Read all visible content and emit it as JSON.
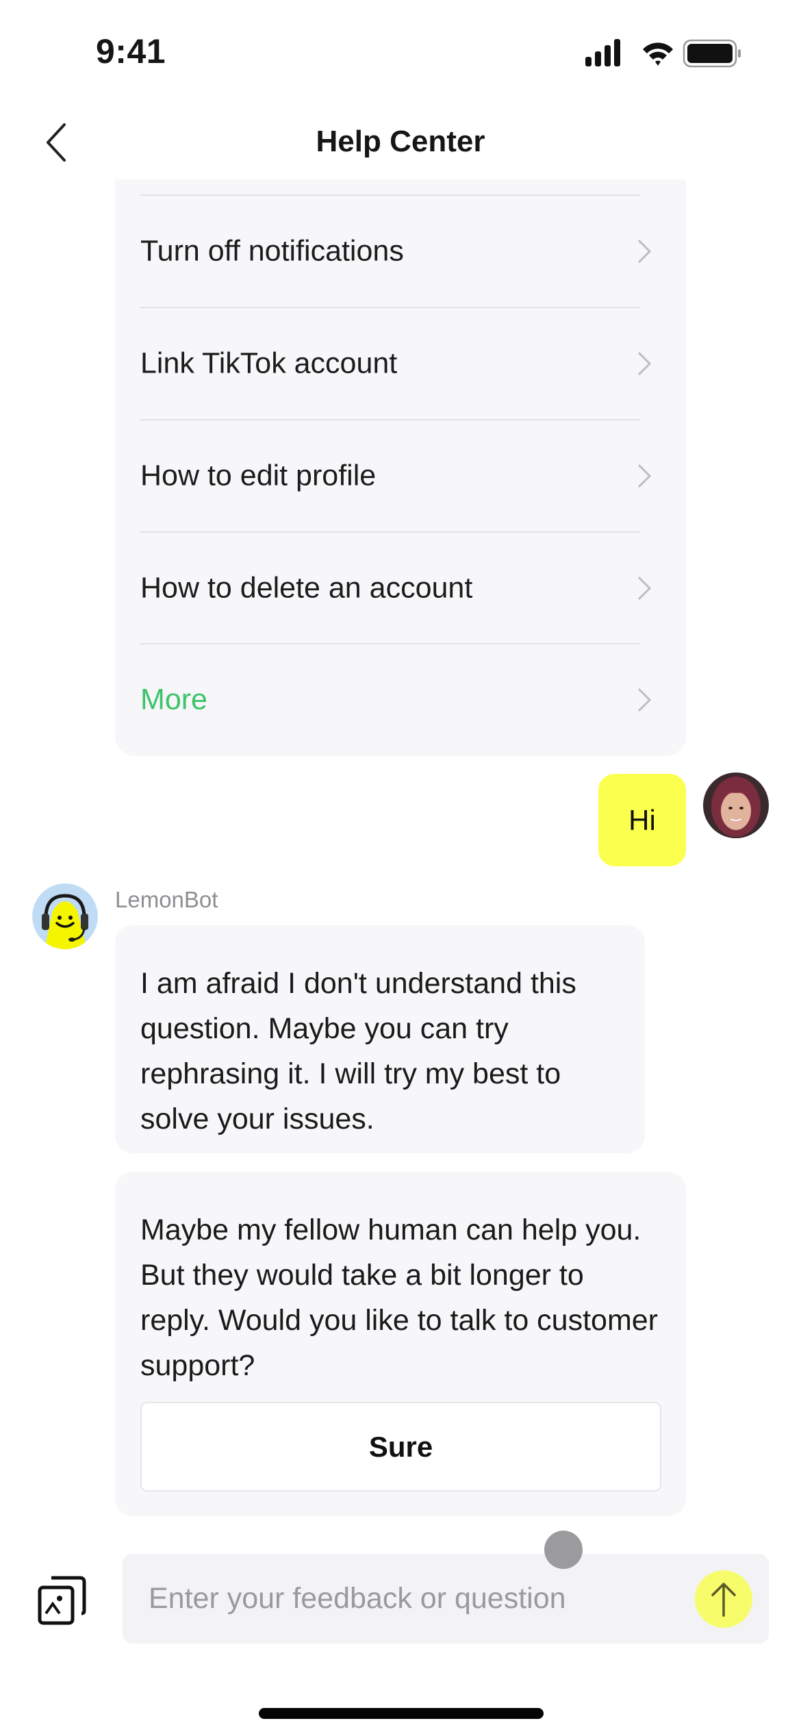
{
  "status_bar": {
    "time": "9:41",
    "icons": [
      "cellular-signal-icon",
      "wifi-icon",
      "battery-icon"
    ]
  },
  "nav": {
    "back_icon": "chevron-left-icon",
    "title": "Help Center"
  },
  "faq": {
    "items": [
      {
        "label": "Turn off notifications"
      },
      {
        "label": "Link TikTok account"
      },
      {
        "label": "How to edit profile"
      },
      {
        "label": "How to delete an account"
      },
      {
        "label": "More"
      }
    ],
    "more_color": "#3cc46a"
  },
  "messages": {
    "user": {
      "text": "Hi",
      "bubble_color": "#fbff4e"
    },
    "bot": {
      "name": "LemonBot",
      "bubble_1": "I am afraid I don't understand this question. Maybe you can try rephrasing it. I will try my best to solve your issues.",
      "bubble_2": "Maybe my fellow human can help you. But they would take a bit longer to reply. Would you like to talk to customer support?",
      "action_button": "Sure"
    }
  },
  "composer": {
    "placeholder": "Enter your feedback or question",
    "value": "",
    "image_icon": "image-gallery-icon",
    "send_icon": "arrow-up-icon",
    "send_color": "#f7fc6a"
  }
}
